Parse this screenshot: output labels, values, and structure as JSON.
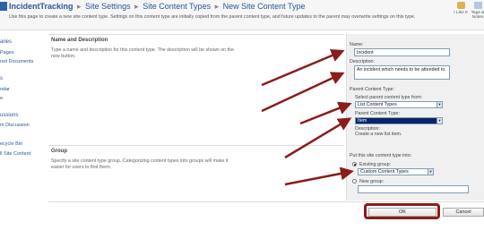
{
  "header": {
    "breadcrumb": [
      "IncidentTracking",
      "Site Settings",
      "Site Content Types",
      "New Site Content Type"
    ],
    "separator": "▸",
    "description": "Use this page to create a new site content type. Settings on this content type are initially copied from the parent content type, and future updates to the parent may overwrite settings on this type.",
    "i_like_it": "I Like It",
    "tags_notes": "Tags & Notes"
  },
  "leftnav": {
    "groups": [
      {
        "head": "aries",
        "items": [
          "Pages",
          "red Documents"
        ]
      },
      {
        "head": "s",
        "items": [
          "ndar",
          "e"
        ]
      },
      {
        "head": "ussions",
        "items": [
          "m Discussion"
        ]
      },
      {
        "head": "",
        "items": [
          "ecycle Bin",
          "ll Site Content"
        ]
      }
    ]
  },
  "name_section": {
    "title": "Name and Description",
    "description": "Type a name and description for this content type. The description will be shown on the new button."
  },
  "group_section": {
    "title": "Group",
    "description": "Specify a site content type group. Categorizing content types into groups will make it easier for users to find them."
  },
  "form": {
    "name_label": "Name:",
    "name_value": "Incident",
    "description_label": "Description:",
    "description_value": "An incident which needs to be attended to.",
    "parent_content_type_label": "Parent Content Type:",
    "select_parent_from_label": "Select parent content type from:",
    "select_parent_from_value": "List Content Types",
    "parent_label": "Parent Content Type:",
    "parent_value": "Item",
    "parent_desc_label": "Description:",
    "parent_desc_value": "Create a new list item.",
    "put_into_label": "Put this site content type into:",
    "existing_group_label": "Existing group:",
    "existing_group_value": "Custom Content Types",
    "new_group_label": "New group:",
    "new_group_value": ""
  },
  "buttons": {
    "ok": "OK",
    "cancel": "Cancel"
  },
  "colors": {
    "link": "#2b5797",
    "annotation": "#8a1c1c",
    "selected": "#0a246a"
  }
}
